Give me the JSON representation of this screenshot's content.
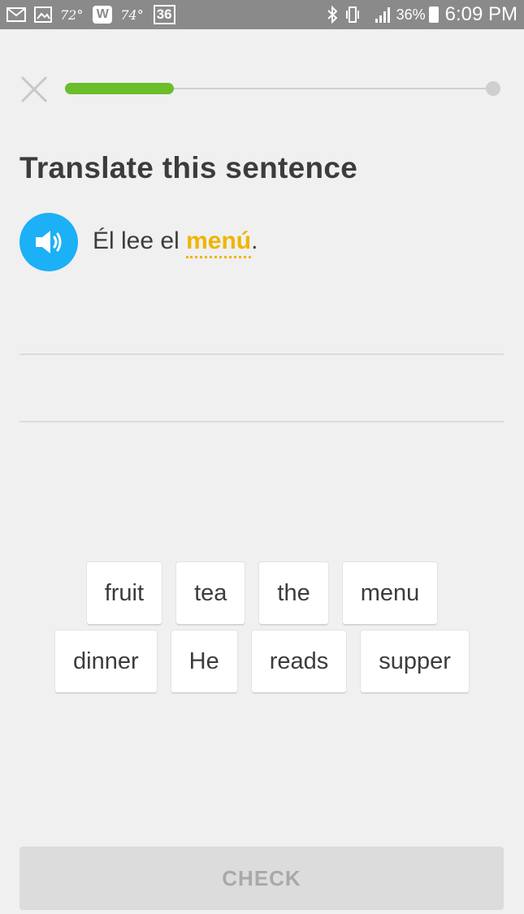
{
  "status_bar": {
    "temp1": "72°",
    "temp2": "74°",
    "badge": "36",
    "w_icon": "W",
    "battery_pct": "36%",
    "time": "6:09 PM",
    "icons": [
      "gmail-icon",
      "image-icon",
      "weather-w-icon",
      "bluetooth-icon",
      "vibrate-icon",
      "signal-icon",
      "battery-icon"
    ]
  },
  "progress": {
    "fraction": 0.25,
    "fill_color": "#6bbd2a"
  },
  "title": "Translate this sentence",
  "prompt": {
    "before": "Él lee el ",
    "hint": "menú",
    "after": ".",
    "speaker_color": "#1cb0f6",
    "hint_color": "#f0b400"
  },
  "word_bank": {
    "rows": [
      [
        "fruit",
        "tea",
        "the",
        "menu"
      ],
      [
        "dinner",
        "He",
        "reads",
        "supper"
      ]
    ]
  },
  "check_label": "CHECK"
}
